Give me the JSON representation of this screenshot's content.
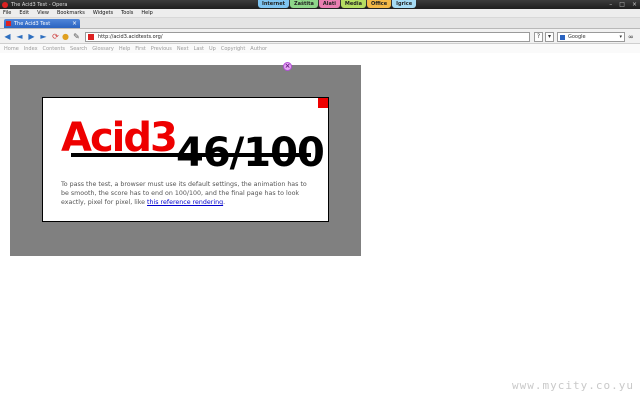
{
  "window": {
    "title": "The Acid3 Test - Opera",
    "category_tabs": [
      {
        "label": "Internet",
        "color": "#7fc4f0"
      },
      {
        "label": "Zaštita",
        "color": "#8ed68a"
      },
      {
        "label": "Alati",
        "color": "#e97fb1"
      },
      {
        "label": "Media",
        "color": "#b5dd62"
      },
      {
        "label": "Office",
        "color": "#f3b948"
      },
      {
        "label": "Igrice",
        "color": "#a6dcf5"
      }
    ],
    "controls": [
      "–",
      "□",
      "×"
    ]
  },
  "menu": [
    "File",
    "Edit",
    "View",
    "Bookmarks",
    "Widgets",
    "Tools",
    "Help"
  ],
  "tab": {
    "title": "The Acid3 Test",
    "close": "×"
  },
  "address": {
    "url": "http://acid3.acidtests.org/",
    "search_engine": "Google"
  },
  "nav_toolbar": [
    "Home",
    "Index",
    "Contents",
    "Search",
    "Glossary",
    "Help",
    "First",
    "Previous",
    "Next",
    "Last",
    "Up",
    "Copyright",
    "Author"
  ],
  "acid": {
    "title": "Acid3",
    "score": "46/100",
    "text_before_link": "To pass the test, a browser must use its default settings, the animation has to be smooth, the score has to end on 100/100, and the final page has to look exactly, pixel for pixel, like ",
    "link_text": "this reference rendering",
    "text_after_link": "."
  },
  "watermark": "www.mycity.co.yu"
}
